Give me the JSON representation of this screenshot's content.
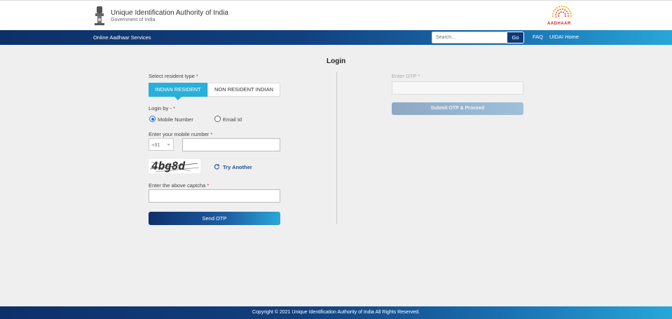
{
  "header": {
    "org_name": "Unique Identification Authority of India",
    "org_sub": "Government of India",
    "logo_text": "AADHAAR"
  },
  "navbar": {
    "title": "Online Aadhaar Services",
    "search_placeholder": "Search...",
    "go_label": "Go",
    "faq_label": "FAQ",
    "home_label": "UIDAI Home"
  },
  "login": {
    "title": "Login",
    "resident_type_label": "Select resident type",
    "tabs": [
      "INDIAN RESIDENT",
      "NON RESIDENT INDIAN"
    ],
    "login_by_label": "Login by -",
    "login_by_options": [
      "Mobile Number",
      "Email Id"
    ],
    "mobile_label": "Enter your mobile number",
    "country_code": "+91",
    "captcha_text": "4bg8d",
    "try_another": "Try Another",
    "captcha_label": "Enter the above captcha",
    "send_otp": "Send OTP",
    "required_mark": "*"
  },
  "otp": {
    "label": "Enter OTP",
    "submit": "Submit OTP & Proceed"
  },
  "footer": {
    "copyright": "Copyright © 2021 Unique Identification Authority of India All Rights Reserved."
  },
  "colors": {
    "nav_dark": "#0d3068",
    "nav_light": "#27a7d8",
    "tab_active": "#29b0d8",
    "go_button": "#0d3b78"
  }
}
